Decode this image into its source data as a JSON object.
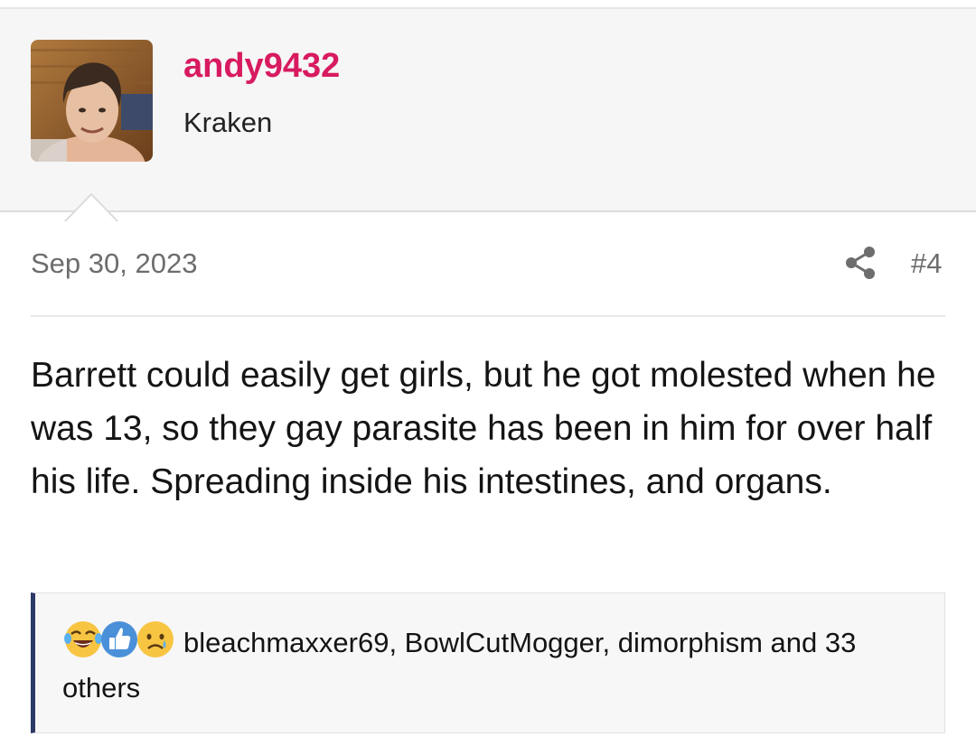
{
  "post": {
    "username": "andy9432",
    "user_title": "Kraken",
    "date": "Sep 30, 2023",
    "post_number": "#4",
    "body": "Barrett could easily get girls, but he got molested when he was 13, so they gay parasite has been in him for over half his life. Spreading inside his intestines, and organs."
  },
  "reactions": {
    "icons": [
      "laughing-crying-emoji-icon",
      "thumbs-up-icon",
      "sad-tear-emoji-icon"
    ],
    "summary": "bleachmaxxer69, BowlCutMogger, dimorphism and 33 others"
  },
  "colors": {
    "username": "#d81b60",
    "header_bg": "#f6f6f6",
    "reaction_accent": "#2b3a67",
    "meta_text": "#6d6d6d"
  }
}
